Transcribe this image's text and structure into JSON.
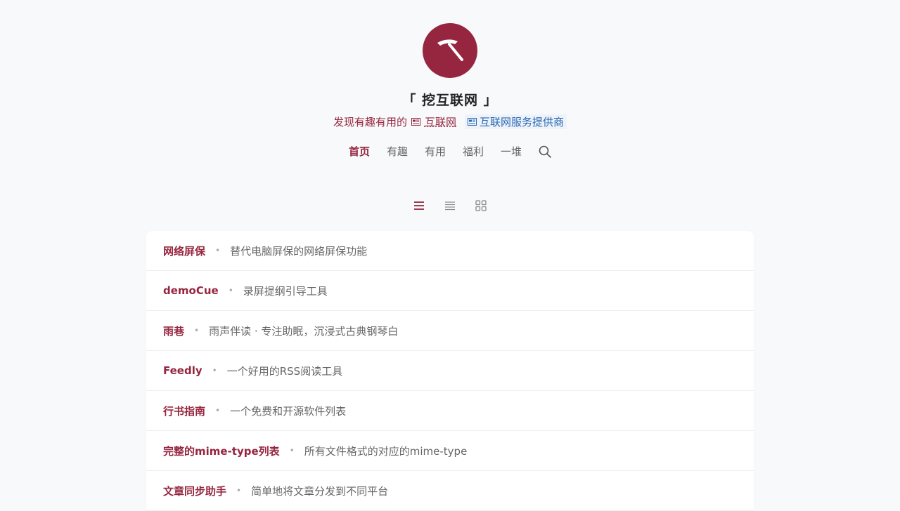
{
  "site": {
    "title": "「 挖互联网 」",
    "subtitle_prefix": "发现有趣有用的",
    "subtitle_highlight": "互联网",
    "provider_label": "互联网服务提供商"
  },
  "nav": {
    "items": [
      {
        "label": "首页",
        "active": true
      },
      {
        "label": "有趣",
        "active": false
      },
      {
        "label": "有用",
        "active": false
      },
      {
        "label": "福利",
        "active": false
      },
      {
        "label": "一堆",
        "active": false
      }
    ]
  },
  "colors": {
    "accent": "#962640",
    "link_blue": "#2a69b0",
    "background": "#f8f9fb"
  },
  "icons": {
    "logo": "pickaxe-icon",
    "search": "search-icon",
    "view_list": "list-view-icon",
    "view_compact": "compact-list-icon",
    "view_grid": "grid-view-icon"
  },
  "list": [
    {
      "name": "网络屏保",
      "desc": "替代电脑屏保的网络屏保功能"
    },
    {
      "name": "demoCue",
      "desc": "录屏提纲引导工具"
    },
    {
      "name": "雨巷",
      "desc": "雨声伴读 · 专注助眠，沉浸式古典钢琴白"
    },
    {
      "name": "Feedly",
      "desc": "一个好用的RSS阅读工具"
    },
    {
      "name": "行书指南",
      "desc": "一个免费和开源软件列表"
    },
    {
      "name": "完整的mime-type列表",
      "desc": "所有文件格式的对应的mime-type"
    },
    {
      "name": "文章同步助手",
      "desc": "简单地将文章分发到不同平台"
    }
  ]
}
